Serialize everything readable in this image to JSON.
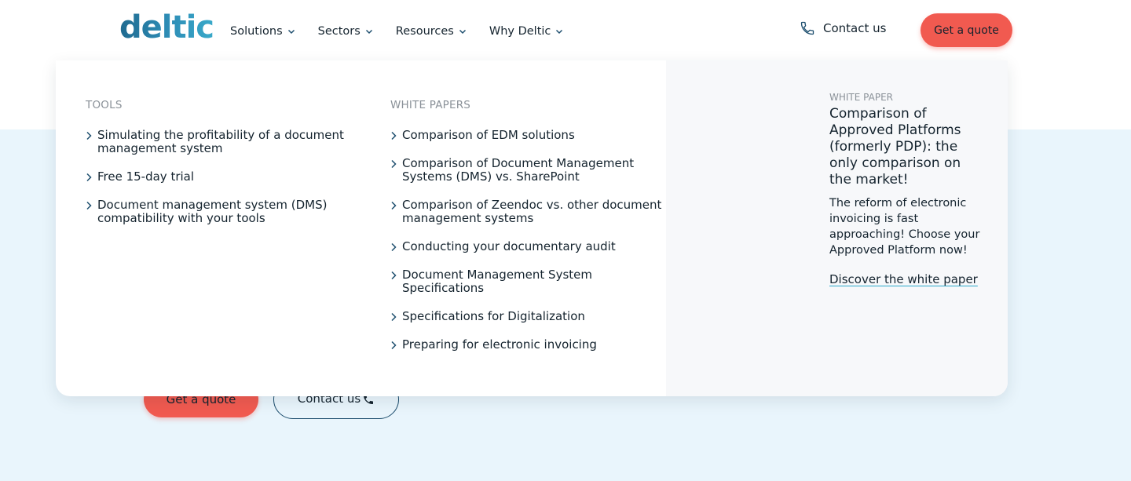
{
  "brand": {
    "logo_text": "deltic",
    "colors": {
      "accent": "#f15a50",
      "navy": "#1d4e6e",
      "hero_bg": "#e9f5fc",
      "panel_side": "#f7f8fa"
    }
  },
  "nav": {
    "items": [
      {
        "label": "Solutions"
      },
      {
        "label": "Sectors"
      },
      {
        "label": "Resources"
      },
      {
        "label": "Why Deltic"
      }
    ],
    "contact_label": "Contact us",
    "quote_label": "Get a quote"
  },
  "hero": {
    "quote_label": "Get a quote",
    "contact_label": "Contact us"
  },
  "mega_menu": {
    "tools": {
      "title": "TOOLS",
      "links": [
        "Simulating the profitability of a document management system",
        "Free 15-day trial",
        "Document management system (DMS) compatibility with your tools"
      ]
    },
    "white_papers": {
      "title": "WHITE PAPERS",
      "links": [
        "Comparison of EDM solutions",
        "Comparison of Document Management Systems (DMS) vs. SharePoint",
        "Comparison of Zeendoc vs. other document management systems",
        "Conducting your documentary audit",
        "Document Management System Specifications",
        "Specifications for Digitalization",
        "Preparing for electronic invoicing"
      ]
    },
    "featured": {
      "eyebrow": "WHITE PAPER",
      "title": "Comparison of Approved Platforms (formerly PDP): the only comparison on the market!",
      "text": "The reform of electronic invoicing is fast approaching! Choose your Approved Platform now!",
      "link_label": "Discover the white paper"
    }
  },
  "icons": [
    "chevron-down-icon",
    "phone-icon",
    "chevron-right-icon"
  ]
}
